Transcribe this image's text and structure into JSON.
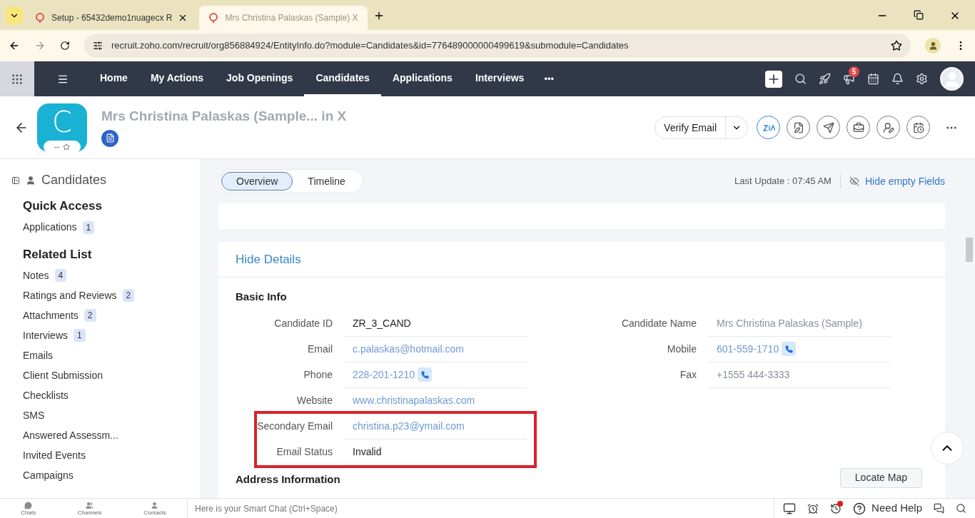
{
  "browser": {
    "tabs": [
      {
        "title": "Setup - 65432demo1nuagecx R",
        "selected": false
      },
      {
        "title": "Mrs Christina Palaskas (Sample) X",
        "selected": true
      }
    ],
    "url": "recruit.zoho.com/recruit/org856884924/EntityInfo.do?module=Candidates&id=776489000000499619&submodule=Candidates"
  },
  "nav": {
    "items": [
      {
        "label": "Home",
        "selected": false
      },
      {
        "label": "My Actions",
        "selected": false
      },
      {
        "label": "Job Openings",
        "selected": false
      },
      {
        "label": "Candidates",
        "selected": true
      },
      {
        "label": "Applications",
        "selected": false
      },
      {
        "label": "Interviews",
        "selected": false
      }
    ],
    "more": "•••",
    "announcements_badge": "5"
  },
  "header": {
    "avatar_letter": "C",
    "rating": "--",
    "name": "Mrs Christina Palaskas (Sample... in X",
    "primary_action": "Verify Email"
  },
  "sidebar": {
    "module": "Candidates",
    "sections": [
      {
        "title": "Quick Access",
        "items": [
          {
            "label": "Applications",
            "count": "1"
          }
        ]
      },
      {
        "title": "Related List",
        "items": [
          {
            "label": "Notes",
            "count": "4"
          },
          {
            "label": "Ratings and Reviews",
            "count": "2"
          },
          {
            "label": "Attachments",
            "count": "2"
          },
          {
            "label": "Interviews",
            "count": "1"
          },
          {
            "label": "Emails"
          },
          {
            "label": "Client Submission"
          },
          {
            "label": "Checklists"
          },
          {
            "label": "SMS"
          },
          {
            "label": "Answered Assessm..."
          },
          {
            "label": "Invited Events"
          },
          {
            "label": "Campaigns"
          }
        ]
      }
    ]
  },
  "view_tabs": [
    {
      "label": "Overview",
      "selected": true
    },
    {
      "label": "Timeline",
      "selected": false
    }
  ],
  "last_update": "Last Update : 07:45 AM",
  "hide_empty": "Hide empty Fields",
  "details": {
    "toggle": "Hide Details",
    "section": "Basic Info",
    "left_fields": [
      {
        "label": "Candidate ID",
        "value": "ZR_3_CAND",
        "kind": "text",
        "highlighted": false
      },
      {
        "label": "Email",
        "value": "c.palaskas@hotmail.com",
        "kind": "link",
        "highlighted": false
      },
      {
        "label": "Phone",
        "value": "228-201-1210",
        "kind": "phone",
        "highlighted": false
      },
      {
        "label": "Website",
        "value": "www.christinapalaskas.com",
        "kind": "link",
        "highlighted": false
      },
      {
        "label": "Secondary Email",
        "value": "christina.p23@ymail.com",
        "kind": "link",
        "highlighted": true
      },
      {
        "label": "Email Status",
        "value": "Invalid",
        "kind": "text",
        "highlighted": true
      }
    ],
    "right_fields": [
      {
        "label": "Candidate Name",
        "value": "Mrs Christina Palaskas (Sample)",
        "kind": "muted",
        "highlighted": false
      },
      {
        "label": "Mobile",
        "value": "601-559-1710",
        "kind": "phone",
        "highlighted": false
      },
      {
        "label": "Fax",
        "value": "+1555 444-3333",
        "kind": "muted",
        "highlighted": false
      }
    ],
    "next_section": "Address Information",
    "locate_map": "Locate Map"
  },
  "bottom_bar": {
    "apps": [
      "Chats",
      "Channels",
      "Contacts"
    ],
    "smart_chat_placeholder": "Here is your Smart Chat (Ctrl+Space)",
    "help": "Need Help"
  }
}
